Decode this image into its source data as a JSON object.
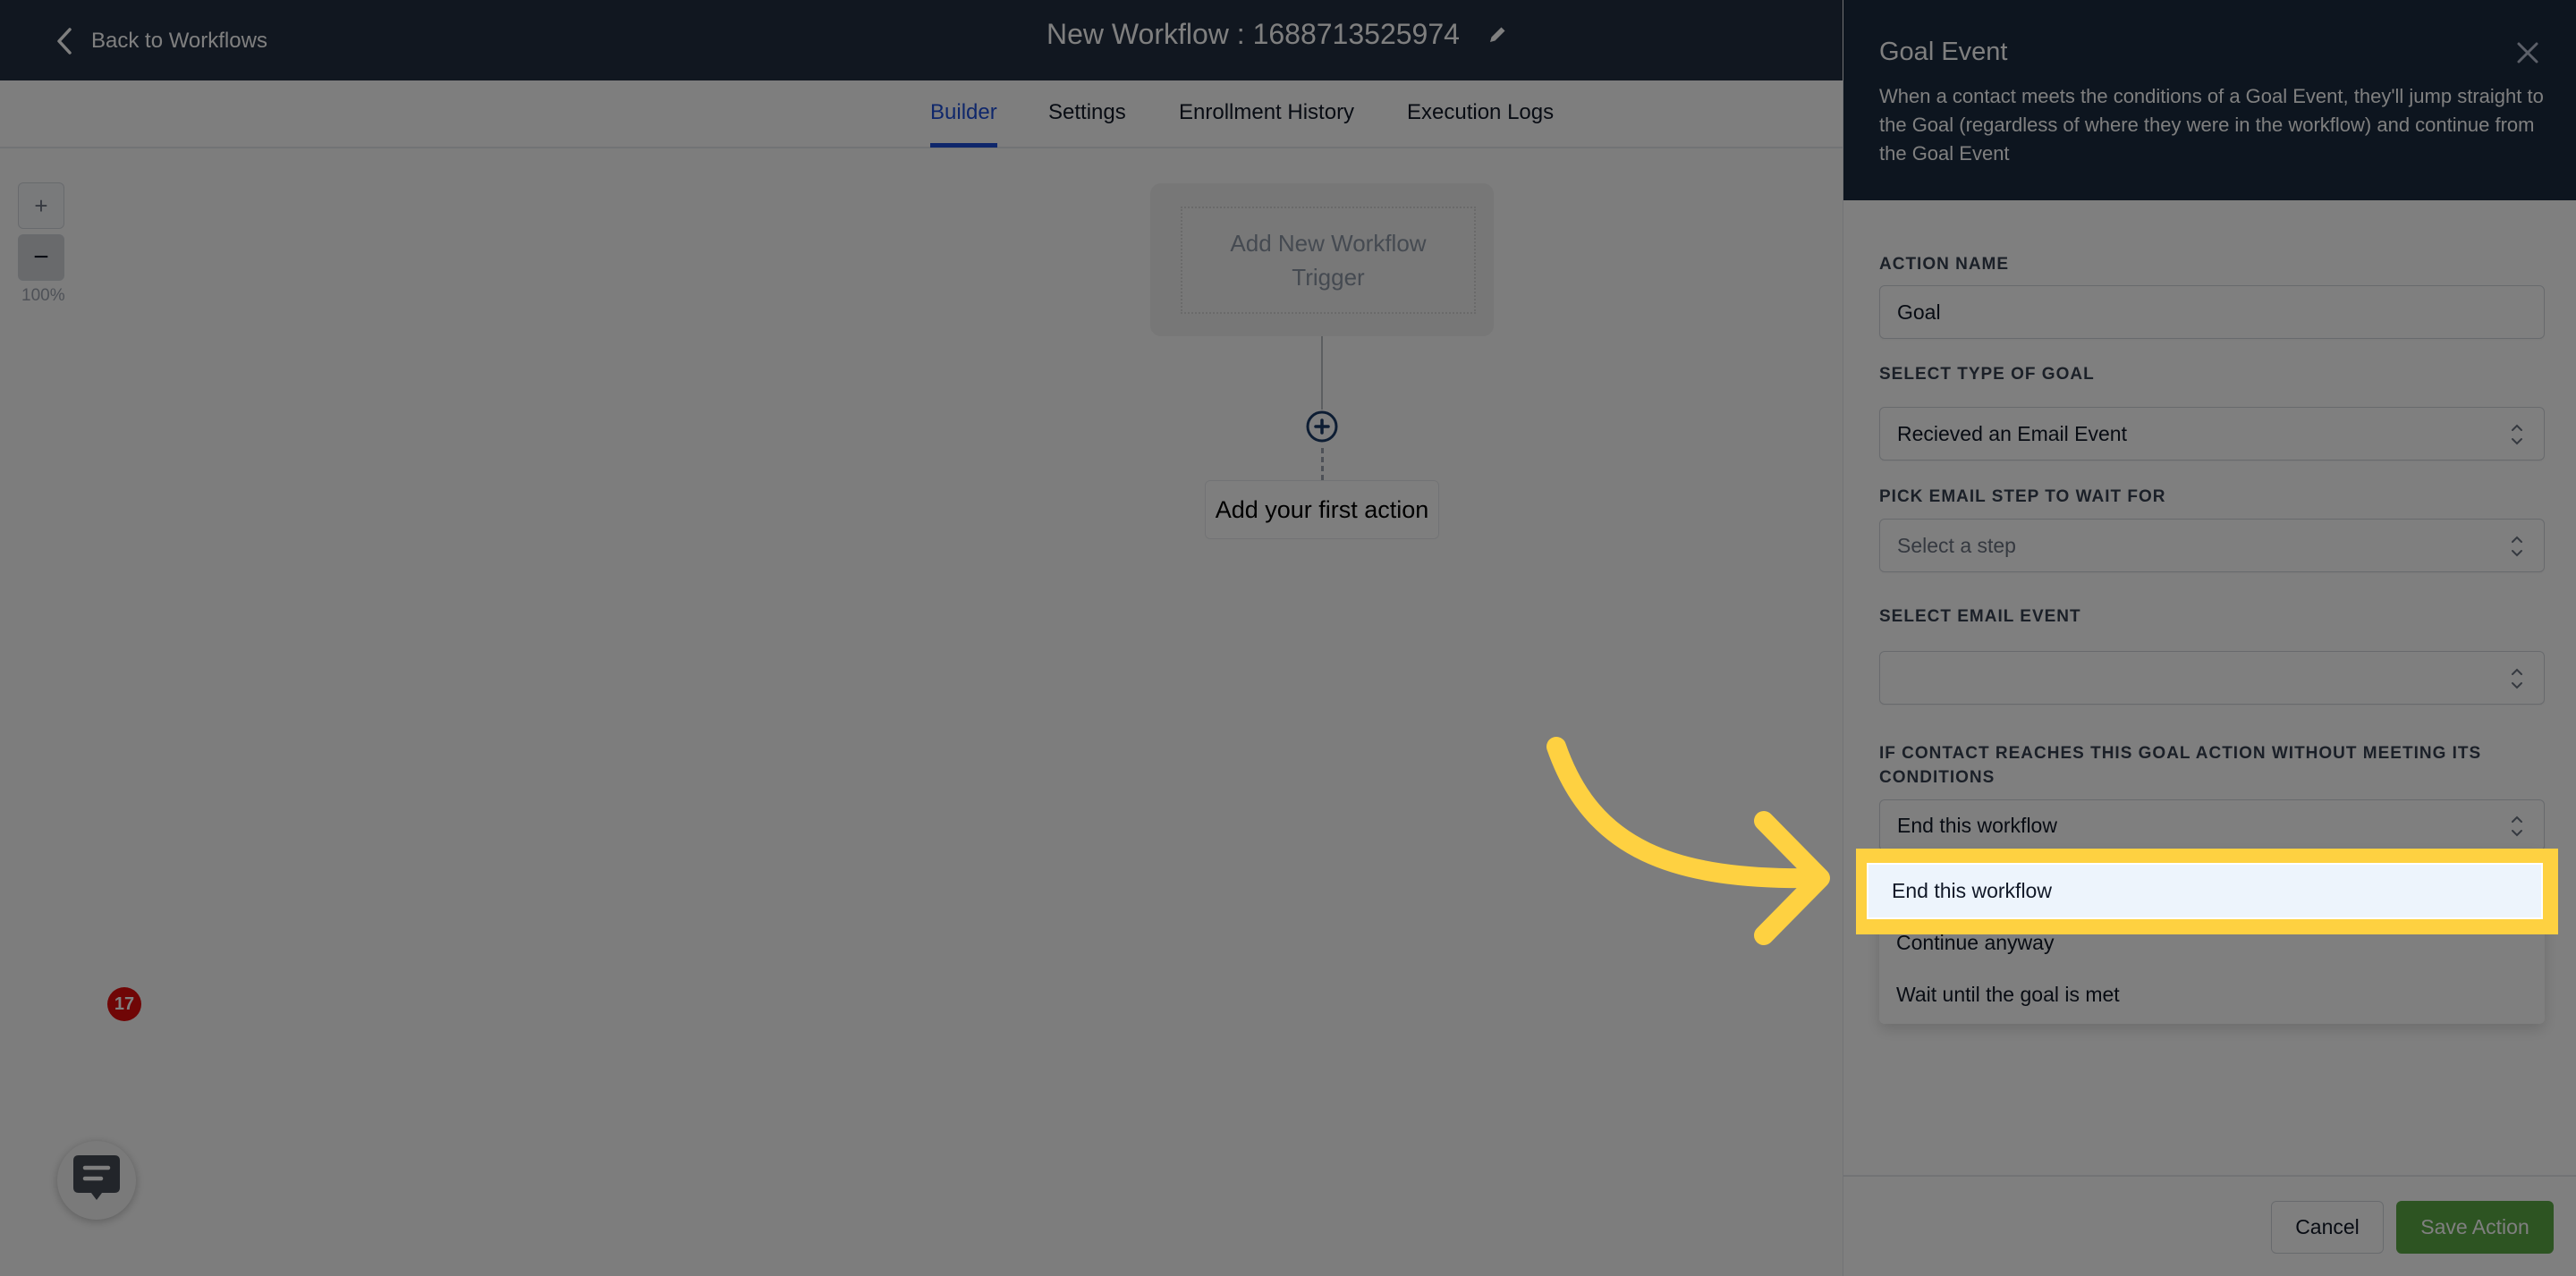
{
  "header": {
    "back_label": "Back to Workflows",
    "title": "New Workflow : 1688713525974"
  },
  "tabs": [
    {
      "label": "Builder",
      "active": true
    },
    {
      "label": "Settings",
      "active": false
    },
    {
      "label": "Enrollment History",
      "active": false
    },
    {
      "label": "Execution Logs",
      "active": false
    }
  ],
  "canvas": {
    "zoom_in_label": "+",
    "zoom_out_label": "−",
    "zoom_level": "100%",
    "trigger_label": "Add New Workflow Trigger",
    "first_action_label": "Add your first action",
    "chat_badge_count": "17"
  },
  "panel": {
    "title": "Goal Event",
    "description": "When a contact meets the conditions of a Goal Event, they'll jump straight to the Goal (regardless of where they were in the workflow) and continue from the Goal Event",
    "fields": {
      "action_name": {
        "label": "ACTION NAME",
        "value": "Goal"
      },
      "goal_type": {
        "label": "SELECT TYPE OF GOAL",
        "value": "Recieved an Email Event"
      },
      "email_step": {
        "label": "PICK EMAIL STEP TO WAIT FOR",
        "placeholder": "Select a step"
      },
      "email_event": {
        "label": "SELECT EMAIL EVENT",
        "value": ""
      },
      "fallback": {
        "label": "IF CONTACT REACHES THIS GOAL ACTION WITHOUT MEETING ITS CONDITIONS",
        "value": "End this workflow",
        "options": [
          "End this workflow",
          "Continue anyway",
          "Wait until the goal is met"
        ],
        "highlighted_option": "End this workflow"
      }
    },
    "cancel_label": "Cancel",
    "save_label": "Save Action"
  },
  "colors": {
    "accent": "#1f4fd6",
    "save_green": "#5aa845",
    "highlight_yellow": "#fed141",
    "header_dark": "#222f41",
    "badge_red": "#e00c0c"
  }
}
